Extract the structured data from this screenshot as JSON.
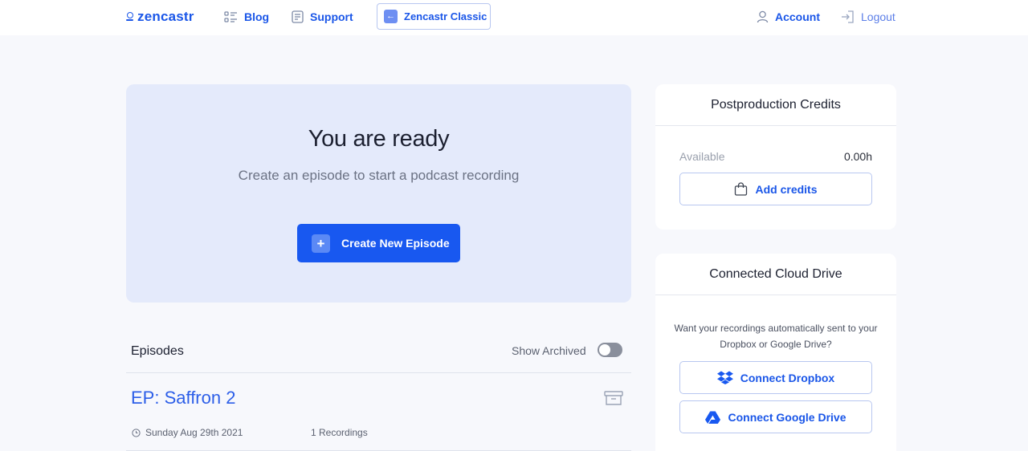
{
  "nav": {
    "logo": "zencastr",
    "blog": "Blog",
    "support": "Support",
    "classic": "Zencastr Classic",
    "account": "Account",
    "logout": "Logout"
  },
  "hero": {
    "title": "You are ready",
    "subtitle": "Create an episode to start a podcast recording",
    "cta": "Create New Episode"
  },
  "episodes": {
    "title": "Episodes",
    "show_archived_label": "Show Archived",
    "show_archived_on": false,
    "items": [
      {
        "title": "EP: Saffron 2",
        "date": "Sunday Aug 29th 2021",
        "recordings": "1 Recordings"
      }
    ]
  },
  "credits": {
    "title": "Postproduction Credits",
    "available_label": "Available",
    "available_value": "0.00h",
    "add_button": "Add credits"
  },
  "cloud": {
    "title": "Connected Cloud Drive",
    "description": "Want your recordings automatically sent to your Dropbox or Google Drive?",
    "dropbox_button": "Connect Dropbox",
    "gdrive_button": "Connect Google Drive"
  },
  "colors": {
    "brand": "#1a56e8",
    "cta": "#1858f0",
    "hero_bg": "#e4eafb",
    "page_bg": "#f7f8fc"
  },
  "icons": {
    "logo": "zencastr-logo-icon",
    "blog": "list-icon",
    "support": "document-icon",
    "classic": "arrow-left-icon",
    "account": "user-icon",
    "logout": "logout-icon",
    "create": "plus-icon",
    "archive": "archive-box-icon",
    "date": "clock-icon",
    "credits": "shopping-bag-icon",
    "dropbox": "dropbox-icon",
    "gdrive": "google-drive-icon"
  }
}
